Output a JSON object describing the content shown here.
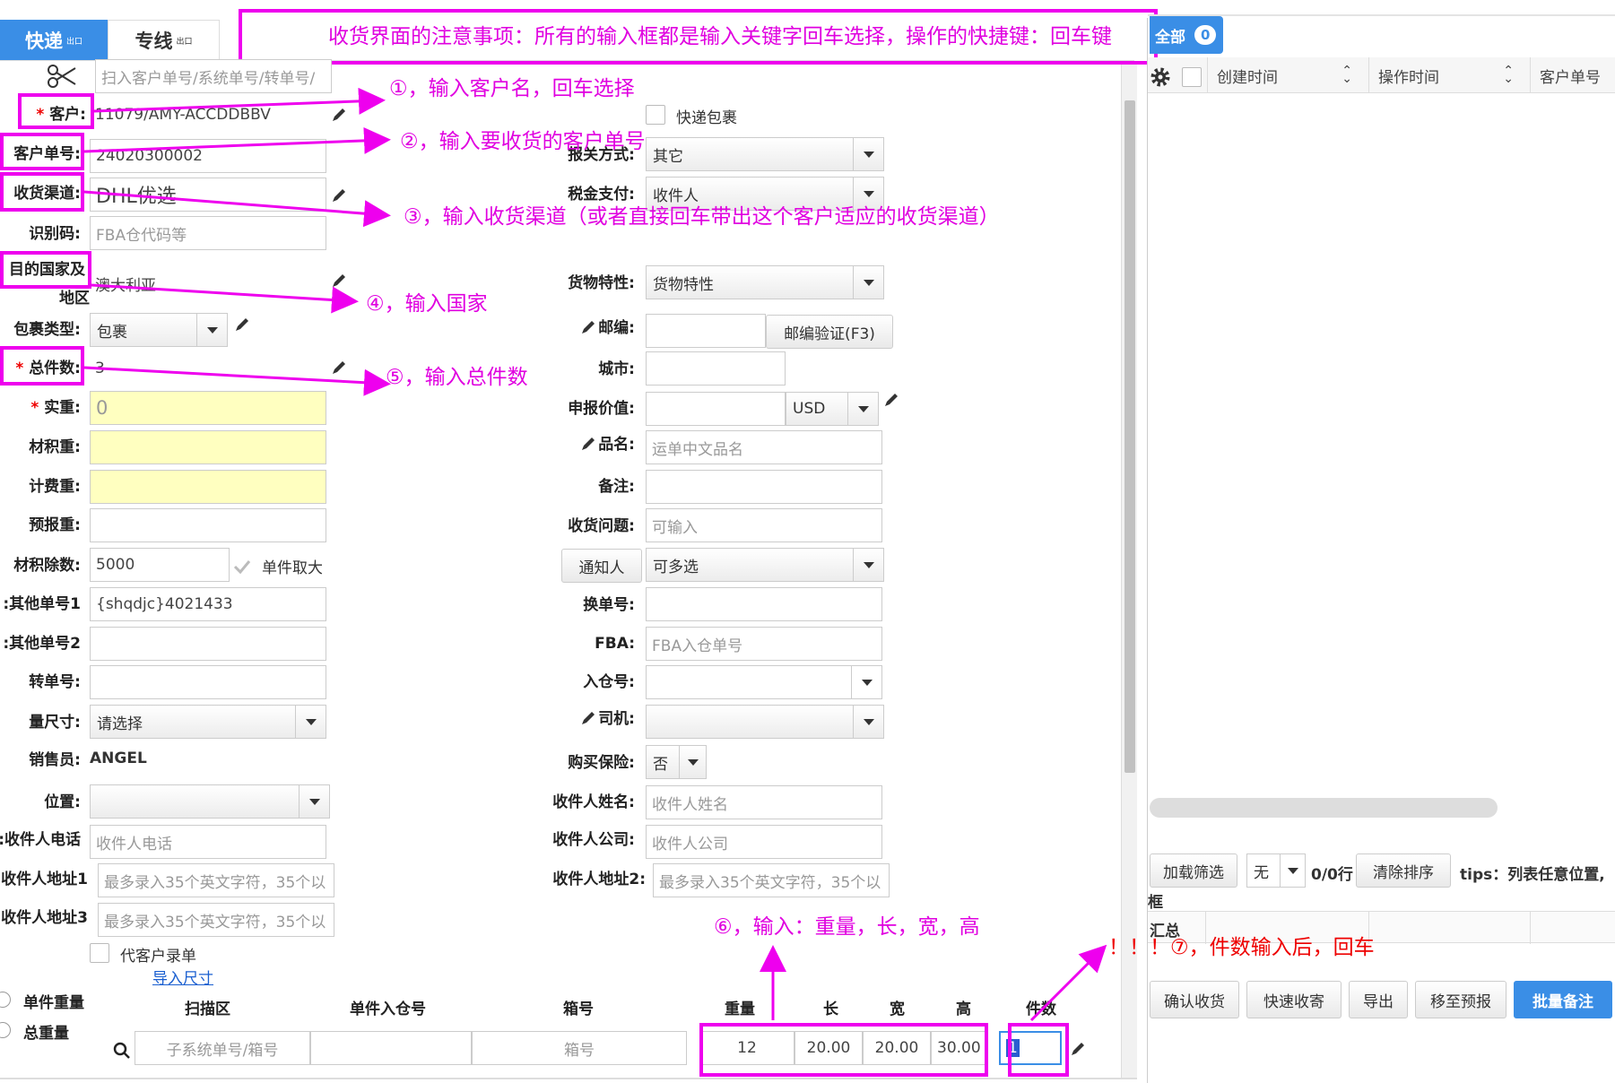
{
  "tabs": {
    "express": "快递",
    "express_sup": "出口",
    "dedicated": "专线",
    "dedicated_sup": "出口"
  },
  "notice": "收货界面的注意事项：所有的输入框都是输入关键字回车选择，操作的快捷键：回车键",
  "form": {
    "scan_placeholder": "扫入客户单号/系统单号/转单号/",
    "customer_label": "客户:",
    "customer_value": "11079/AMY-ACCDDBBV",
    "express_pkg": "快递包裹",
    "customer_no_label": "客户单号:",
    "customer_no_value": "24020300002",
    "customs_label": "报关方式:",
    "customs_value": "其它",
    "channel_label": "收货渠道:",
    "channel_value": "DHL优选",
    "tax_label": "税金支付:",
    "tax_value": "收件人",
    "idcode_label": "识别码:",
    "idcode_placeholder": "FBA仓代码等",
    "dest_label_1": "目的国家及",
    "dest_label_2": "地区",
    "dest_value": "澳大利亚",
    "goods_label": "货物特性:",
    "goods_value": "货物特性",
    "pkg_type_label": "包裹类型:",
    "pkg_type_value": "包裹",
    "zip_label": "邮编:",
    "zip_btn": "邮编验证(F3)",
    "total_pcs_label": "总件数:",
    "total_pcs_value": "3",
    "city_label": "城市:",
    "actual_weight_label": "实重:",
    "actual_weight_value": "0",
    "declared_value_label": "申报价值:",
    "currency_value": "USD",
    "volume_weight_label": "材积重:",
    "product_name_label": "品名:",
    "product_name_placeholder": "运单中文品名",
    "charge_weight_label": "计费重:",
    "remark_label": "备注:",
    "forecast_weight_label": "预报重:",
    "receive_issue_label": "收货问题:",
    "receive_issue_placeholder": "可输入",
    "divisor_label": "材积除数:",
    "divisor_value": "5000",
    "single_max": "单件取大",
    "notify_btn": "通知人",
    "notify_value": "可多选",
    "other_no1_label": "其他单号1:",
    "other_no1_value": "{shqdjc}4021433",
    "change_no_label": "换单号:",
    "other_no2_label": "其他单号2:",
    "fba_label": "FBA:",
    "fba_placeholder": "FBA入仓单号",
    "transfer_no_label": "转单号:",
    "warehouse_no_label": "入仓号:",
    "measure_label": "量尺寸:",
    "measure_value": "请选择",
    "driver_label": "司机:",
    "sales_label": "销售员:",
    "sales_value": "ANGEL",
    "insurance_label": "购买保险:",
    "insurance_value": "否",
    "position_label": "位置:",
    "consignee_name_label": "收件人姓名:",
    "consignee_name_placeholder": "收件人姓名",
    "phone_label": "收件人电话:",
    "phone_placeholder": "收件人电话",
    "company_label": "收件人公司:",
    "company_placeholder": "收件人公司",
    "addr1_label": "收件人地址1:",
    "addr1_placeholder": "最多录入35个英文字符，35个以",
    "addr2_label": "收件人地址2:",
    "addr2_placeholder": "最多录入35个英文字符，35个以",
    "addr3_label": "收件人地址3:",
    "addr3_placeholder": "最多录入35个英文字符，35个以",
    "proxy_entry": "代客户录单",
    "import_size": "导入尺寸"
  },
  "pieces": {
    "unit_weight": "单件重量",
    "total_weight": "总重量",
    "headers": [
      "扫描区",
      "单件入仓号",
      "箱号",
      "重量",
      "长",
      "宽",
      "高",
      "件数"
    ],
    "sub_placeholder": "子系统单号/箱号",
    "box_placeholder": "箱号",
    "weight": "12",
    "length": "20.00",
    "width": "20.00",
    "height": "30.00",
    "count": "1"
  },
  "right": {
    "all_label": "全部",
    "all_count": "0",
    "cols": [
      "创建时间",
      "操作时间",
      "客户单号"
    ],
    "load_filter": "加载筛选",
    "filter_value": "无",
    "row_count": "0/0行",
    "clear_sort": "清除排序",
    "tips": "tips：列表任意位置,",
    "frame_frag": "框",
    "summary_frag": "汇总",
    "actions": [
      "确认收货",
      "快速收寄",
      "导出",
      "移至预报",
      "批量备注"
    ]
  },
  "annotations": {
    "a1": "①，输入客户名，回车选择",
    "a2": "②，输入要收货的客户单号",
    "a3": "③，输入收货渠道（或者直接回车带出这个客户适应的收货渠道）",
    "a4": "④，输入国家",
    "a5": "⑤，输入总件数",
    "a6": "⑥，输入：重量，长，宽，高",
    "a7": "！！！⑦，件数输入后，回车"
  },
  "colors": {
    "tab_active": "#3a8ee6",
    "annotation": "#e000e0",
    "warning": "#ee0000",
    "primary_btn": "#3a8ee6"
  }
}
